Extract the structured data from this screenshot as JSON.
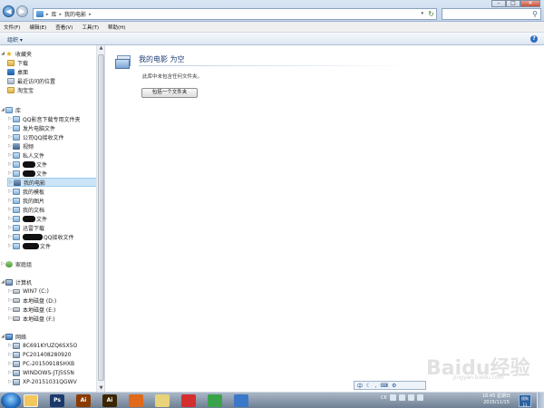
{
  "window": {
    "breadcrumb": [
      "库",
      "我的电影"
    ],
    "controls": {
      "minimize": "–",
      "maximize": "□",
      "close": "✕"
    }
  },
  "menu": [
    "文件(F)",
    "编辑(E)",
    "查看(V)",
    "工具(T)",
    "帮助(H)"
  ],
  "command_bar": {
    "organize": "组织 ▾",
    "help": "?"
  },
  "sidebar": {
    "favorites": {
      "header": "收藏夹",
      "items": [
        "下载",
        "桌面",
        "最近访问的位置",
        "淘宝宝"
      ]
    },
    "libraries": {
      "header": "库",
      "items": [
        {
          "label": "QQ影音下载专用文件夹",
          "redacted": false
        },
        {
          "label": "发片电脑文件",
          "redacted": false
        },
        {
          "label": "公司QQ接收文件",
          "redacted": false
        },
        {
          "label": "视频",
          "redacted": false
        },
        {
          "label": "私人文件",
          "redacted": false
        },
        {
          "label": "文件",
          "redacted": true
        },
        {
          "label": "文件",
          "redacted": true
        },
        {
          "label": "我的电影",
          "redacted": false,
          "selected": true
        },
        {
          "label": "我的模板",
          "redacted": false
        },
        {
          "label": "我的图片",
          "redacted": false
        },
        {
          "label": "我的文档",
          "redacted": false
        },
        {
          "label": "文件",
          "redacted": true
        },
        {
          "label": "迅雷下载",
          "redacted": false
        },
        {
          "label": "QQ接收文件",
          "redacted": true
        },
        {
          "label": "文件",
          "redacted": true
        }
      ]
    },
    "homegroup": {
      "header": "家庭组"
    },
    "computer": {
      "header": "计算机",
      "items": [
        "WIN7 (C:)",
        "本地磁盘 (D:)",
        "本地磁盘 (E:)",
        "本地磁盘 (F:)"
      ]
    },
    "network": {
      "header": "网络",
      "items": [
        "8C691KYUZQ6SX5O",
        "PC201408280920",
        "PC-20150918SHXB",
        "WINDOWS-JTJ5S5N",
        "XP-20151031QGWV"
      ]
    }
  },
  "content": {
    "title": "我的电影 为空",
    "description": "此库中未包含任何文件夹。",
    "include_button": "包括一个文件夹"
  },
  "taskbar": {
    "apps": [
      {
        "name": "windows-explorer",
        "color": "#f2c75c",
        "active": true
      },
      {
        "name": "photoshop",
        "label": "Ps",
        "color": "#1b3a6b"
      },
      {
        "name": "illustrator",
        "label": "Ai",
        "color": "#8a3b00"
      },
      {
        "name": "illustrator-2",
        "label": "Ai",
        "color": "#3a2500"
      },
      {
        "name": "firefox",
        "color": "#e06a1a"
      },
      {
        "name": "folder",
        "color": "#e8d27a"
      },
      {
        "name": "app-red",
        "color": "#d32f2f"
      },
      {
        "name": "app-green",
        "color": "#3aa34a"
      },
      {
        "name": "app-blue",
        "color": "#3c78c8"
      }
    ],
    "tray_lang": "CK",
    "ime_status": "中",
    "clock_time": "16:45 星期日",
    "clock_date": "2015/11/15",
    "badge": "搜狗 11"
  },
  "watermark": {
    "text": "Baidu经验",
    "sub": "jingyan.baidu.com"
  }
}
